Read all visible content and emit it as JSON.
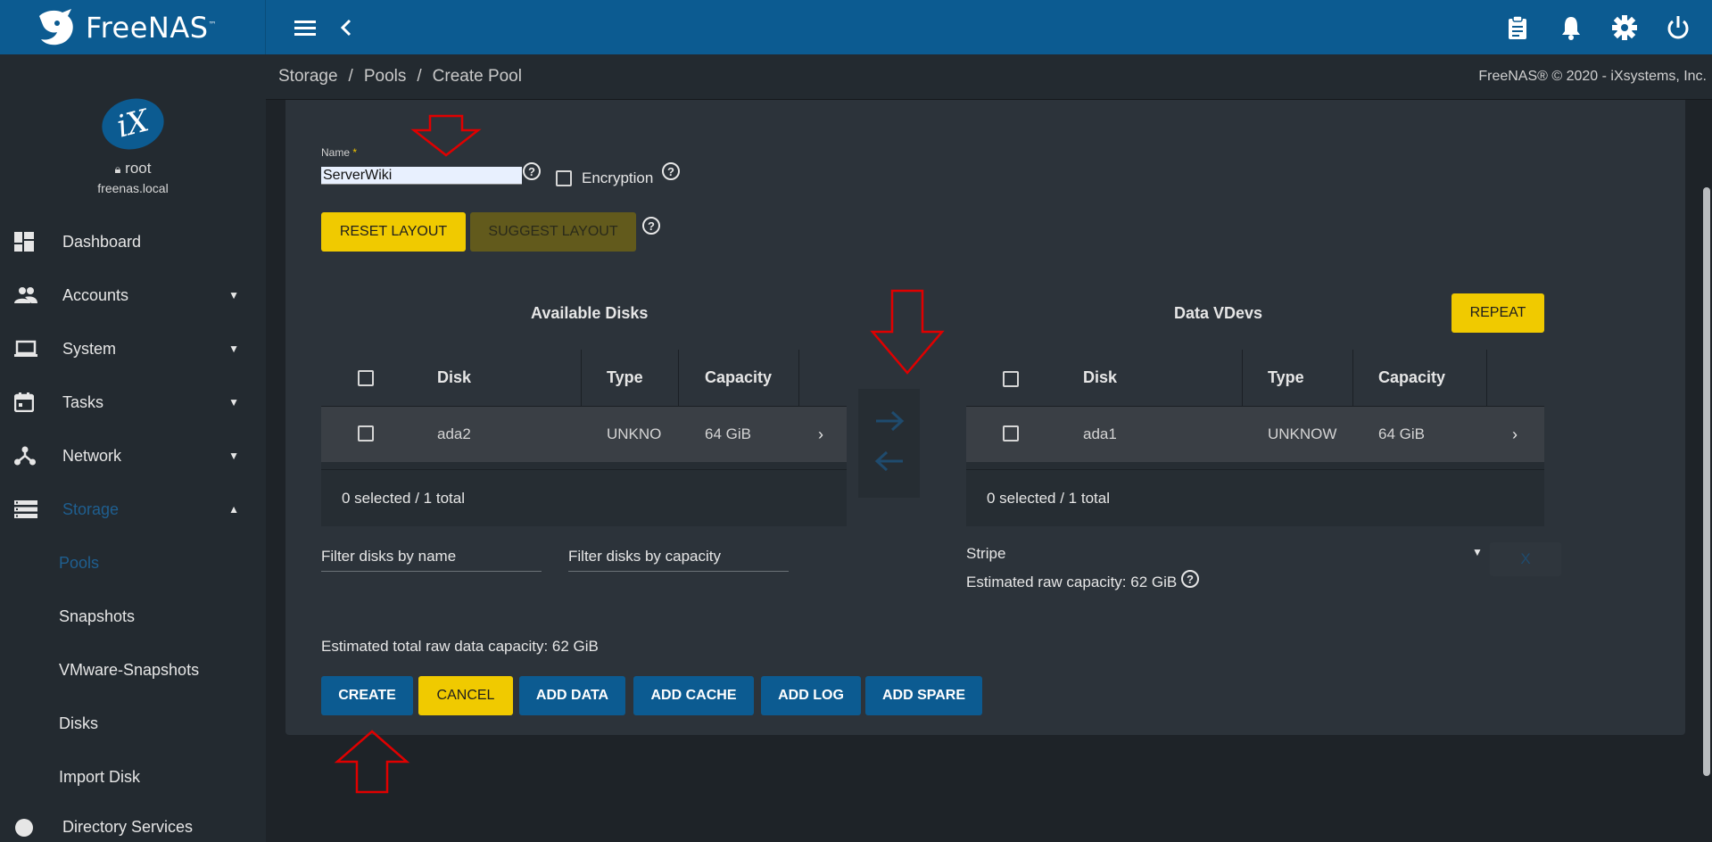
{
  "topbar": {
    "brand": "FreeNAS",
    "brand_tm": "™",
    "menu_icon": "hamburger-icon",
    "back_icon": "chevron-left-icon",
    "right_icons": [
      "clipboard-icon",
      "bell-icon",
      "gear-icon",
      "power-icon"
    ]
  },
  "sidebar": {
    "logo_text": "iX",
    "user": "root",
    "host": "freenas.local",
    "items": [
      {
        "label": "Dashboard",
        "icon": "dashboard-icon"
      },
      {
        "label": "Accounts",
        "icon": "accounts-icon"
      },
      {
        "label": "System",
        "icon": "laptop-icon"
      },
      {
        "label": "Tasks",
        "icon": "calendar-icon"
      },
      {
        "label": "Network",
        "icon": "network-icon"
      },
      {
        "label": "Storage",
        "icon": "storage-icon"
      }
    ],
    "storage_sub": [
      "Pools",
      "Snapshots",
      "VMware-Snapshots",
      "Disks",
      "Import Disk"
    ],
    "next_item_partial": "Directory Services"
  },
  "breadcrumb": {
    "items": [
      "Storage",
      "Pools",
      "Create Pool"
    ],
    "sep": "/",
    "copyright": "FreeNAS® © 2020 - iXsystems, Inc."
  },
  "form": {
    "name_label": "Name",
    "required_mark": "*",
    "name_value": "ServerWiki",
    "encryption_label": "Encryption",
    "reset_layout": "RESET LAYOUT",
    "suggest_layout": "SUGGEST LAYOUT"
  },
  "available": {
    "title": "Available Disks",
    "headers": [
      "Disk",
      "Type",
      "Capacity"
    ],
    "rows": [
      {
        "disk": "ada2",
        "type": "UNKNO",
        "capacity": "64 GiB"
      }
    ],
    "footer": "0 selected / 1 total",
    "filter_name": "Filter disks by name",
    "filter_capacity": "Filter disks by capacity"
  },
  "vdevs": {
    "title": "Data VDevs",
    "repeat": "REPEAT",
    "headers": [
      "Disk",
      "Type",
      "Capacity"
    ],
    "rows": [
      {
        "disk": "ada1",
        "type": "UNKNOW",
        "capacity": "64 GiB"
      }
    ],
    "footer": "0 selected / 1 total",
    "layout": "Stripe",
    "estimated_raw": "Estimated raw capacity: 62 GiB",
    "remove": "X"
  },
  "summary": {
    "estimated_total": "Estimated total raw data capacity: 62 GiB"
  },
  "actions": {
    "create": "CREATE",
    "cancel": "CANCEL",
    "add_data": "ADD DATA",
    "add_cache": "ADD CACHE",
    "add_log": "ADD LOG",
    "add_spare": "ADD SPARE"
  },
  "colors": {
    "topbar": "#0c5b91",
    "yellow": "#f0ca00",
    "annotation": "#e00000"
  }
}
